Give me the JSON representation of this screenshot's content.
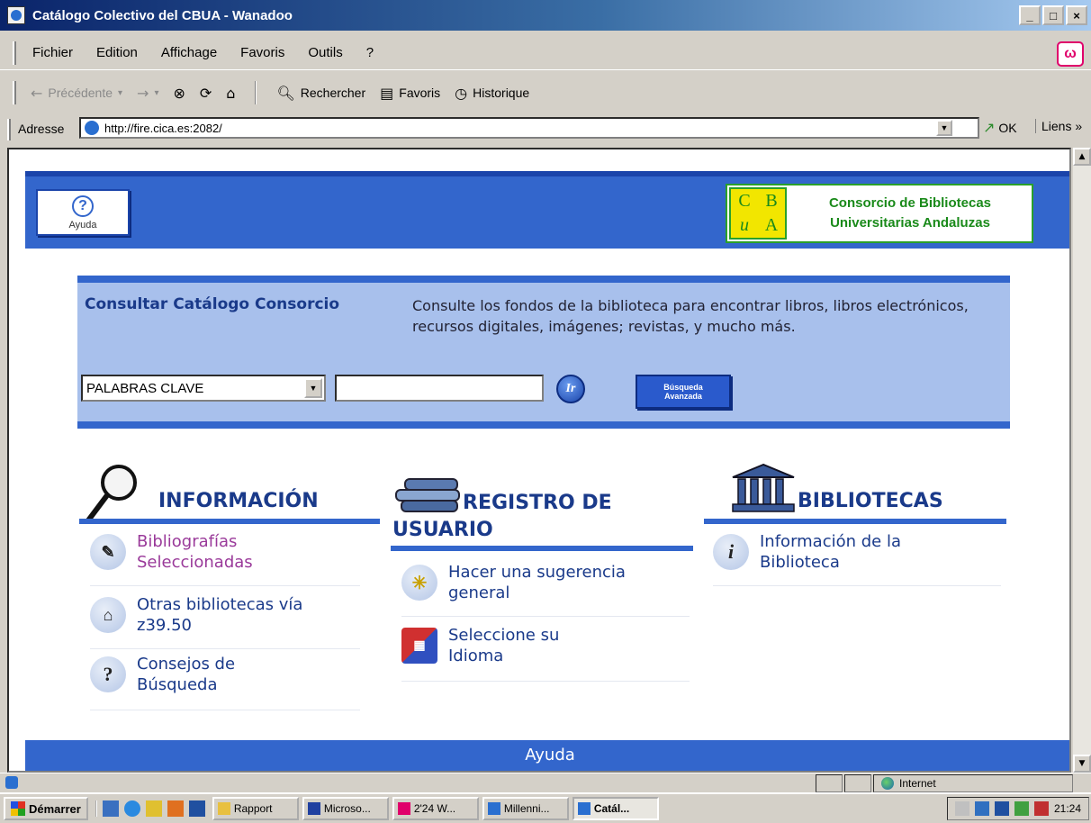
{
  "window": {
    "title": "Catálogo Colectivo del CBUA - Wanadoo",
    "controls": [
      "_",
      "□",
      "×"
    ]
  },
  "menu": [
    "Fichier",
    "Edition",
    "Affichage",
    "Favoris",
    "Outils",
    "?"
  ],
  "toolbar": {
    "back": "Précédente",
    "search": "Rechercher",
    "favorites": "Favoris",
    "history": "Historique"
  },
  "address": {
    "label": "Adresse",
    "url": "http://fire.cica.es:2082/",
    "go": "OK",
    "links": "Liens"
  },
  "header": {
    "help_label": "Ayuda",
    "logo_letters": [
      "C",
      "B",
      "u",
      "A"
    ],
    "org_line1": "Consorcio de Bibliotecas",
    "org_line2": "Universitarias Andaluzas"
  },
  "search": {
    "title": "Consultar Catálogo Consorcio",
    "description": "Consulte los fondos de la biblioteca para encontrar libros, libros electrónicos, recursos digitales, imágenes; revistas, y mucho más.",
    "select_value": "PALABRAS CLAVE",
    "go_label": "Ir",
    "advanced_line1": "Búsqueda",
    "advanced_line2": "Avanzada"
  },
  "sections": {
    "info": {
      "title": "INFORMACIÓN",
      "items": [
        "Bibliografías Seleccionadas",
        "Otras bibliotecas vía z39.50",
        "Consejos de Búsqueda"
      ]
    },
    "registro": {
      "title_line1": "REGISTRO DE",
      "title_line2": "USUARIO",
      "items": [
        "Hacer una sugerencia general",
        "Seleccione su Idioma"
      ]
    },
    "bibliotecas": {
      "title": "BIBLIOTECAS",
      "items": [
        "Información de la Biblioteca"
      ]
    }
  },
  "footer_band": "Ayuda",
  "status": {
    "zone": "Internet"
  },
  "taskbar": {
    "start": "Démarrer",
    "tasks": [
      "Rapport",
      "Microso...",
      "2'24 W...",
      "Millenni...",
      "Catál..."
    ],
    "clock": "21:24"
  }
}
